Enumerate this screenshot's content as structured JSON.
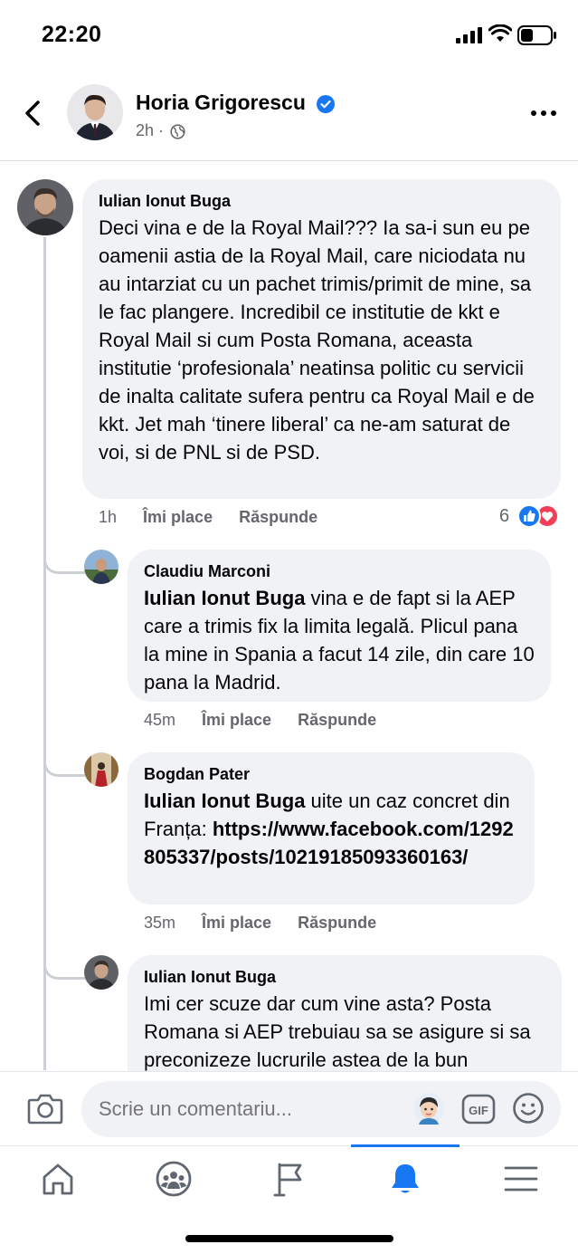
{
  "status_bar": {
    "time": "22:20"
  },
  "post": {
    "author": "Horia Grigorescu",
    "time": "2h"
  },
  "comments": [
    {
      "author": "Iulian Ionut Buga",
      "text": "Deci vina e de la Royal Mail??? Ia sa-i sun eu pe oamenii astia de la Royal Mail, care niciodata nu au intarziat cu un pachet trimis/primit de mine, sa le fac plangere. Incredibil ce institutie de kkt e Royal Mail si cum Posta Romana, aceasta institutie ‘profesionala’ neatinsa politic cu servicii de inalta calitate sufera pentru ca Royal Mail e de kkt. Jet mah ‘tinere liberal’ ca ne-am saturat de voi, si de PNL si de PSD.",
      "time": "1h",
      "like_label": "Îmi place",
      "reply_label": "Răspunde",
      "reaction_count": "6"
    },
    {
      "author": "Claudiu Marconi",
      "mention": "Iulian Ionut Buga",
      "text": " vina e de fapt si la AEP care a trimis fix la limita legală. Plicul pana la mine in Spania a facut 14 zile, din care 10 pana la Madrid.",
      "time": "45m",
      "like_label": "Îmi place",
      "reply_label": "Răspunde"
    },
    {
      "author": "Bogdan Pater",
      "mention": "Iulian Ionut Buga",
      "text": " uite un caz concret din Franța: ",
      "link": "https://www.facebook.com/1292805337/posts/10219185093360163/",
      "time": "35m",
      "like_label": "Îmi place",
      "reply_label": "Răspunde"
    },
    {
      "author": "Iulian Ionut Buga",
      "text": "Imi cer scuze dar cum vine asta? Posta Romana si AEP trebuiau sa se asigure si sa preconizeze lucrurile astea de la bun"
    }
  ],
  "composer": {
    "placeholder": "Scrie un comentariu...",
    "gif_label": "GIF"
  },
  "colors": {
    "accent": "#1877f2",
    "bubble": "#f0f2f5",
    "secondary_text": "#65676b",
    "love": "#f33e58"
  },
  "icons": [
    "back-icon",
    "verified-icon",
    "globe-icon",
    "more-icon",
    "like-reaction-icon",
    "love-reaction-icon",
    "camera-icon",
    "avatar-sticker-icon",
    "gif-icon",
    "emoji-icon",
    "home-icon",
    "groups-icon",
    "pages-icon",
    "notifications-icon",
    "menu-icon"
  ]
}
